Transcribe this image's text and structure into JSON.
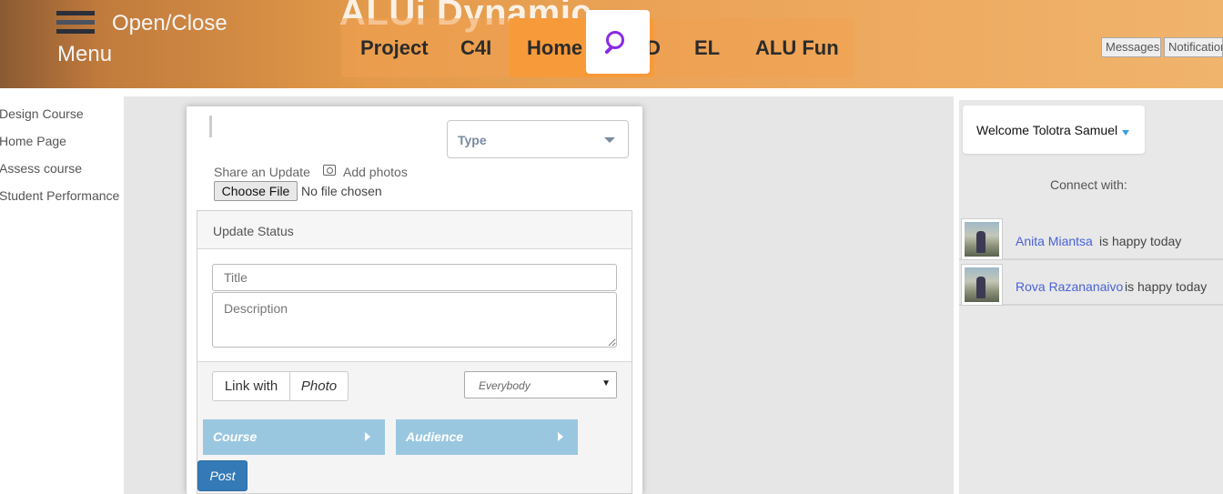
{
  "header": {
    "menu_label_line1": "Open/Close",
    "menu_label_line2": "Menu",
    "brand": "ALUi Dynamic",
    "nav": [
      {
        "label": "Project"
      },
      {
        "label": "C4I"
      },
      {
        "label": "Home"
      },
      {
        "label": "D"
      },
      {
        "label": "EL"
      },
      {
        "label": "ALU Fun"
      }
    ],
    "messages_label": "Messages",
    "notifications_label": "Notifications"
  },
  "sidebar": {
    "items": [
      {
        "label": "Design Course"
      },
      {
        "label": "Home Page"
      },
      {
        "label": "Assess course"
      },
      {
        "label": "Student Performance"
      }
    ]
  },
  "composer": {
    "type_label": "Type",
    "share_label": "Share an Update",
    "add_photos_label": "Add photos",
    "choose_file_label": "Choose File",
    "no_file_label": "No file chosen",
    "panel_title": "Update Status",
    "title_placeholder": "Title",
    "description_placeholder": "Description",
    "link_with_label": "Link with",
    "photo_label": "Photo",
    "audience_value": "Everybody",
    "course_label": "Course",
    "audience_label": "Audience",
    "post_label": "Post"
  },
  "right_panel": {
    "welcome": "Welcome Tolotra Samuel",
    "connect_label": "Connect with:",
    "friends": [
      {
        "name": "Anita Miantsa",
        "status": "is happy today"
      },
      {
        "name": "Rova Razananaivo",
        "status": "is happy today"
      }
    ]
  },
  "colors": {
    "header_accent": "#f79a3a",
    "search_icon": "#8a2be2",
    "post_button": "#337ab7",
    "dropdown_blue": "#9ac7e0",
    "link_blue": "#4a62d6"
  }
}
